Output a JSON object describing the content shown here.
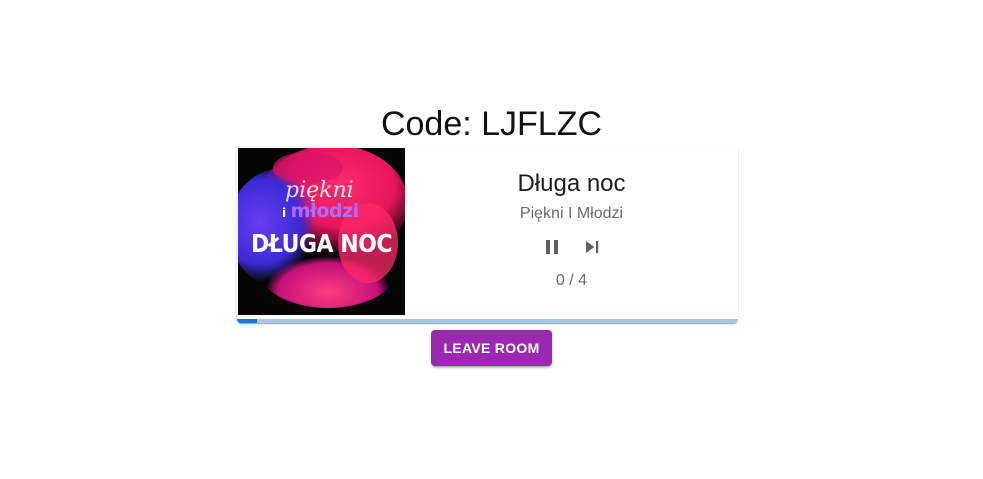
{
  "room": {
    "code_label": "Code: LJFLZC"
  },
  "player": {
    "title": "Długa noc",
    "artist": "Piękni I Młodzi",
    "votes": "0 / 4",
    "progress_fraction": 0.04,
    "controls": {
      "pause_icon": "pause-icon",
      "skip_icon": "skip-next-icon"
    },
    "cover": {
      "artist_logo_line1": "piękni",
      "artist_logo_prefix": "i",
      "artist_logo_line2": "młodzi",
      "album_text": "DŁUGA NOC"
    }
  },
  "actions": {
    "leave_label": "LEAVE ROOM"
  },
  "colors": {
    "accent": "#9c27b0",
    "progress_fill": "#1976d2",
    "progress_track": "#a7c6ea"
  }
}
